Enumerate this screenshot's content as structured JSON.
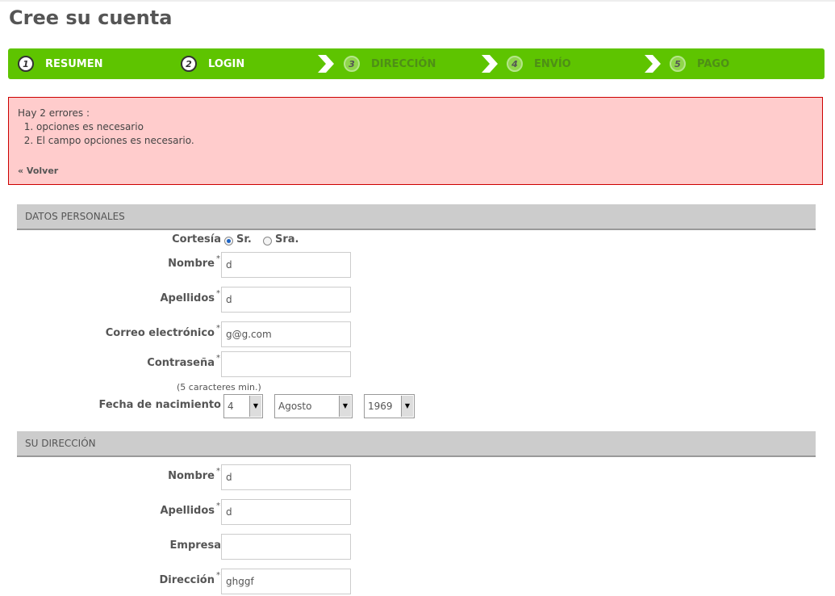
{
  "page": {
    "title": "Cree su cuenta"
  },
  "steps": [
    {
      "num": "1",
      "label": "RESUMEN",
      "state": "done"
    },
    {
      "num": "2",
      "label": "LOGIN",
      "state": "done"
    },
    {
      "num": "3",
      "label": "DIRECCIÓN",
      "state": "todo"
    },
    {
      "num": "4",
      "label": "ENVÍO",
      "state": "todo"
    },
    {
      "num": "5",
      "label": "PAGO",
      "state": "todo"
    }
  ],
  "errors": {
    "heading": "Hay 2 errores :",
    "items": [
      "opciones es necesario",
      "El campo opciones es necesario."
    ],
    "back_label": "« Volver"
  },
  "personal": {
    "section_title": "DATOS PERSONALES",
    "courtesy_label": "Cortesía",
    "courtesy_options": [
      "Sr.",
      "Sra."
    ],
    "courtesy_selected": "Sr.",
    "first_name_label": "Nombre",
    "first_name_value": "d",
    "last_name_label": "Apellidos",
    "last_name_value": "d",
    "email_label": "Correo electrónico",
    "email_value": "g@g.com",
    "password_label": "Contraseña",
    "password_value": "",
    "password_hint": "(5 caracteres min.)",
    "birth_label": "Fecha de nacimiento",
    "birth_day": "4",
    "birth_month": "Agosto",
    "birth_year": "1969"
  },
  "address": {
    "section_title": "SU DIRECCIÓN",
    "first_name_label": "Nombre",
    "first_name_value": "d",
    "last_name_label": "Apellidos",
    "last_name_value": "d",
    "company_label": "Empresa",
    "company_value": "",
    "address_label": "Dirección",
    "address_value": "ghggf"
  },
  "required_mark": "*",
  "colors": {
    "progress_bar": "#5ec400",
    "error_bg": "#ffcccc",
    "error_border": "#cc0000",
    "section_bg": "#cccccc"
  }
}
